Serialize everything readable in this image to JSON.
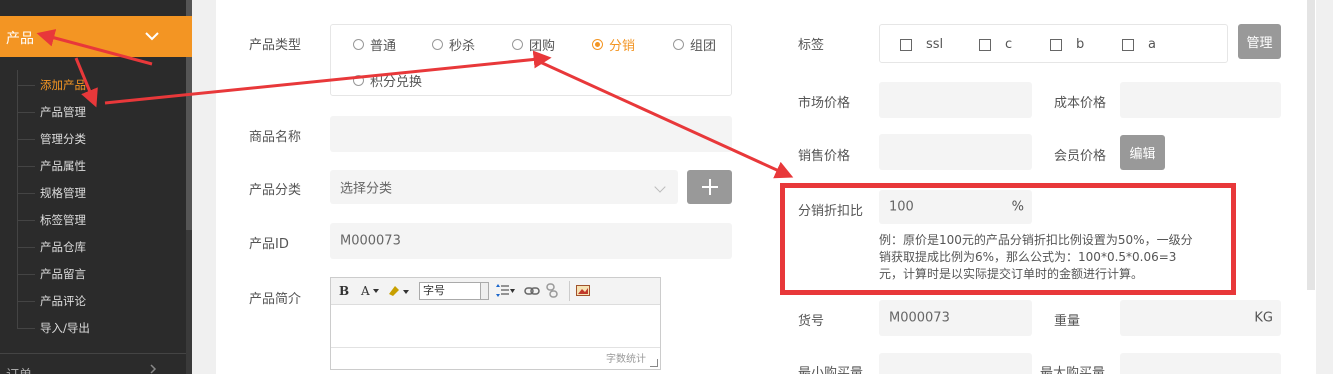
{
  "sidebar": {
    "top_partial": "",
    "active_group": "产品",
    "sub_items": [
      {
        "label": "添加产品",
        "active": true
      },
      {
        "label": "产品管理",
        "active": false
      },
      {
        "label": "管理分类",
        "active": false
      },
      {
        "label": "产品属性",
        "active": false
      },
      {
        "label": "规格管理",
        "active": false
      },
      {
        "label": "标签管理",
        "active": false
      },
      {
        "label": "产品仓库",
        "active": false
      },
      {
        "label": "产品留言",
        "active": false
      },
      {
        "label": "产品评论",
        "active": false
      },
      {
        "label": "导入/导出",
        "active": false
      }
    ],
    "bottom_group": "订单"
  },
  "form": {
    "product_type_label": "产品类型",
    "product_types": [
      {
        "label": "普通",
        "checked": false
      },
      {
        "label": "秒杀",
        "checked": false
      },
      {
        "label": "团购",
        "checked": false
      },
      {
        "label": "分销",
        "checked": true
      },
      {
        "label": "组团",
        "checked": false
      },
      {
        "label": "积分兑换",
        "checked": false
      }
    ],
    "name_label": "商品名称",
    "name_value": "",
    "category_label": "产品分类",
    "category_value": "选择分类",
    "add_category_icon": "plus-icon",
    "id_label": "产品ID",
    "id_value": "M000073",
    "intro_label": "产品简介",
    "editor": {
      "font_size_placeholder": "字号",
      "word_count_label": "字数统计",
      "bold": "B",
      "font_color": "A"
    }
  },
  "right": {
    "tags_label": "标签",
    "tags": [
      "ssl",
      "c",
      "b",
      "a"
    ],
    "manage_button": "管理",
    "market_price_label": "市场价格",
    "market_price_value": "",
    "cost_price_label": "成本价格",
    "cost_price_value": "",
    "sale_price_label": "销售价格",
    "sale_price_value": "",
    "member_price_label": "会员价格",
    "edit_button": "编辑",
    "discount_label": "分销折扣比",
    "discount_value": "100",
    "discount_unit": "%",
    "hint_text": "例：原价是100元的产品分销折扣比例设置为50%，一级分销获取提成比例为6%，那么公式为：100*0.5*0.06=3元，计算时是以实际提交订单时的金额进行计算。",
    "sku_label": "货号",
    "sku_value": "M000073",
    "weight_label": "重量",
    "weight_unit": "KG",
    "min_buy_label": "最小购买量",
    "max_buy_label": "最大购买量"
  },
  "colors": {
    "accent": "#f39523",
    "sidebar_bg": "#2b2b2b",
    "annotation_red": "#e8383a",
    "button_grey": "#999999"
  }
}
